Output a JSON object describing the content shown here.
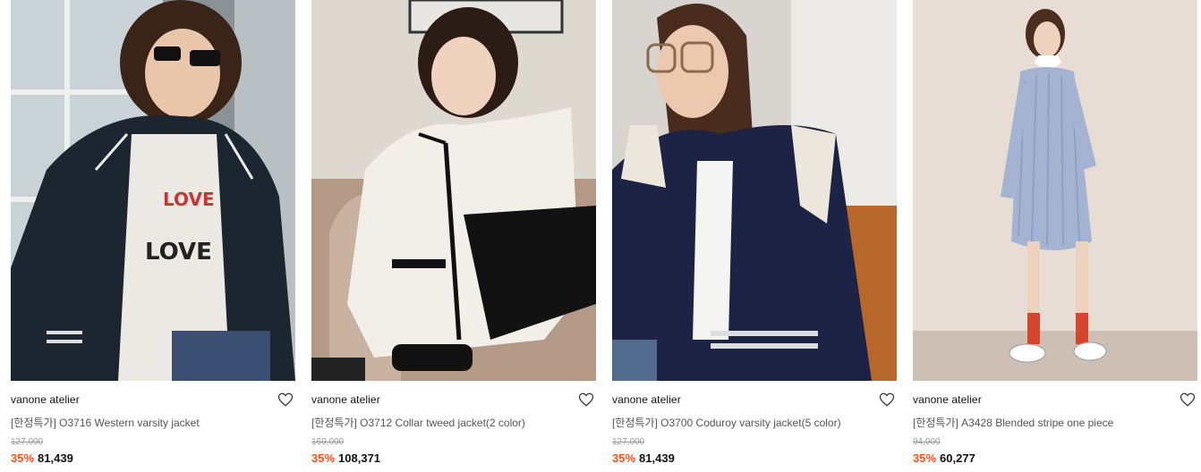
{
  "colors": {
    "discount": "#ff4f1e",
    "brand_text": "#111111",
    "title_text": "#555555",
    "original_price": "#999999"
  },
  "products": [
    {
      "image_desc": "woman in sunglasses wearing black western varsity jacket with white piping over graphic tee",
      "brand": "vanone atelier",
      "title": "[한정특가] O3716 Western varsity jacket",
      "original_price": "127,000",
      "discount": "35%",
      "price": "81,439",
      "wishlist_icon": "heart-outline-icon"
    },
    {
      "image_desc": "woman seated in armchair wearing cream tweed jacket with black trim and black skirt",
      "brand": "vanone atelier",
      "title": "[한정특가] O3712 Collar tweed jacket(2 color)",
      "original_price": "169,000",
      "discount": "35%",
      "price": "108,371",
      "wishlist_icon": "heart-outline-icon"
    },
    {
      "image_desc": "woman in glasses wearing navy corduroy varsity jacket with cream sleeve panels",
      "brand": "vanone atelier",
      "title": "[한정특가] O3700 Coduroy varsity jacket(5 color)",
      "original_price": "127,000",
      "discount": "35%",
      "price": "81,439",
      "wishlist_icon": "heart-outline-icon"
    },
    {
      "image_desc": "woman wearing blue stripe shirt dress with red socks and white sneakers",
      "brand": "vanone atelier",
      "title": "[한정특가] A3428 Blended stripe one piece",
      "original_price": "94,000",
      "discount": "35%",
      "price": "60,277",
      "wishlist_icon": "heart-outline-icon"
    }
  ]
}
